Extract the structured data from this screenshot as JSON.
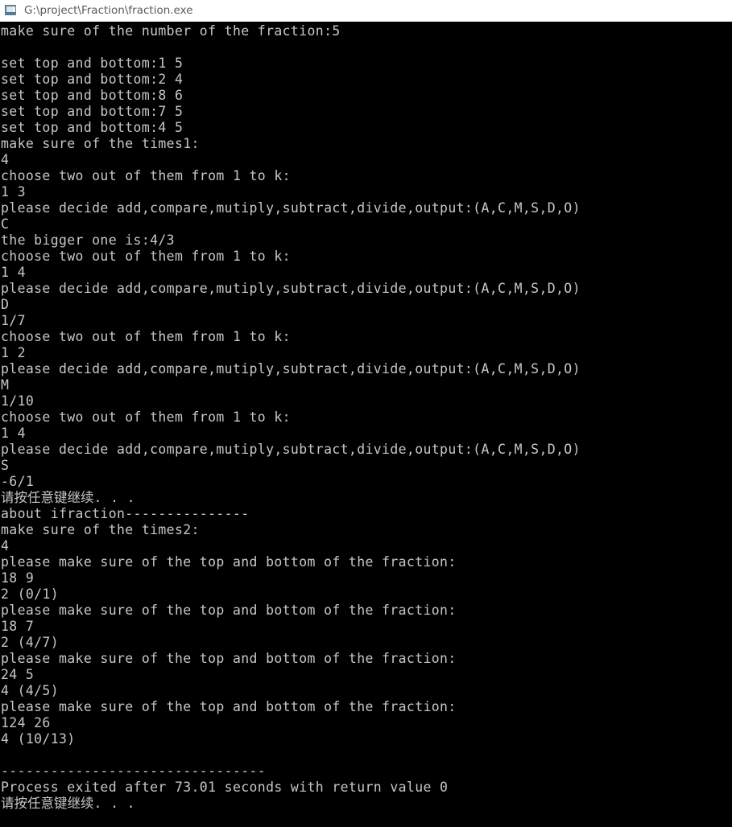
{
  "window": {
    "title": "G:\\project\\Fraction\\fraction.exe",
    "icon": "console-app-icon",
    "titlebar_bg": "#ffffff",
    "titlebar_fg": "#5a5a5a"
  },
  "console": {
    "background": "#000000",
    "foreground": "#c6c6c6",
    "font_size_px": 16.5,
    "line_height_px": 20,
    "lines": [
      "make sure of the number of the fraction:5",
      "",
      "set top and bottom:1 5",
      "set top and bottom:2 4",
      "set top and bottom:8 6",
      "set top and bottom:7 5",
      "set top and bottom:4 5",
      "make sure of the times1:",
      "4",
      "choose two out of them from 1 to k:",
      "1 3",
      "please decide add,compare,mutiply,subtract,divide,output:(A,C,M,S,D,O)",
      "C",
      "the bigger one is:4/3",
      "choose two out of them from 1 to k:",
      "1 4",
      "please decide add,compare,mutiply,subtract,divide,output:(A,C,M,S,D,O)",
      "D",
      "1/7",
      "choose two out of them from 1 to k:",
      "1 2",
      "please decide add,compare,mutiply,subtract,divide,output:(A,C,M,S,D,O)",
      "M",
      "1/10",
      "choose two out of them from 1 to k:",
      "1 4",
      "please decide add,compare,mutiply,subtract,divide,output:(A,C,M,S,D,O)",
      "S",
      "-6/1",
      "请按任意键继续. . .",
      "about ifraction---------------",
      "make sure of the times2:",
      "4",
      "please make sure of the top and bottom of the fraction:",
      "18 9",
      "2 (0/1)",
      "please make sure of the top and bottom of the fraction:",
      "18 7",
      "2 (4/7)",
      "please make sure of the top and bottom of the fraction:",
      "24 5",
      "4 (4/5)",
      "please make sure of the top and bottom of the fraction:",
      "124 26",
      "4 (10/13)",
      "",
      "--------------------------------",
      "Process exited after 73.01 seconds with return value 0",
      "请按任意键继续. . ."
    ]
  },
  "program": {
    "fraction_count_prompt": "make sure of the number of the fraction:",
    "fraction_count": "5",
    "fractions": [
      {
        "top": "1",
        "bottom": "5"
      },
      {
        "top": "2",
        "bottom": "4"
      },
      {
        "top": "8",
        "bottom": "6"
      },
      {
        "top": "7",
        "bottom": "5"
      },
      {
        "top": "4",
        "bottom": "5"
      }
    ],
    "times1_prompt": "make sure of the times1:",
    "times1": "4",
    "operations": [
      {
        "pick": "1 3",
        "op": "C",
        "result": "the bigger one is:4/3"
      },
      {
        "pick": "1 4",
        "op": "D",
        "result": "1/7"
      },
      {
        "pick": "1 2",
        "op": "M",
        "result": "1/10"
      },
      {
        "pick": "1 4",
        "op": "S",
        "result": "-6/1"
      }
    ],
    "op_legend": "please decide add,compare,mutiply,subtract,divide,output:(A,C,M,S,D,O)",
    "section_header": "about ifraction---------------",
    "times2_prompt": "make sure of the times2:",
    "times2": "4",
    "ifractions": [
      {
        "input": "18 9",
        "output": "2 (0/1)"
      },
      {
        "input": "18 7",
        "output": "2 (4/7)"
      },
      {
        "input": "24 5",
        "output": "4 (4/5)"
      },
      {
        "input": "124 26",
        "output": "4 (10/13)"
      }
    ],
    "pause_message": "请按任意键继续. . .",
    "exit_message": "Process exited after 73.01 seconds with return value 0",
    "exit_seconds": "73.01",
    "exit_code": "0"
  }
}
